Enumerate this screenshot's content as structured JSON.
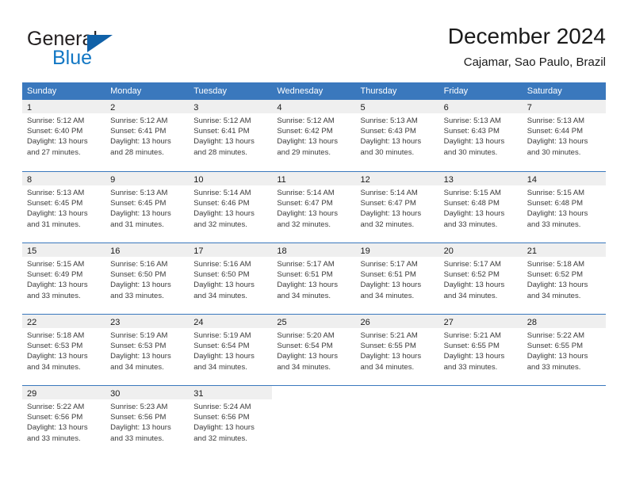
{
  "logo": {
    "word_one": "General",
    "word_two": "Blue",
    "triangle_color": "#1061a8",
    "blue_text_color": "#1277c4"
  },
  "header": {
    "title": "December 2024",
    "location": "Cajamar, Sao Paulo, Brazil"
  },
  "theme": {
    "header_blue": "#3a78bd",
    "day_band_gray": "#efefef",
    "text_color": "#3a3a3a"
  },
  "weekdays": [
    "Sunday",
    "Monday",
    "Tuesday",
    "Wednesday",
    "Thursday",
    "Friday",
    "Saturday"
  ],
  "weeks": [
    [
      {
        "day": "1",
        "sunrise": "Sunrise: 5:12 AM",
        "sunset": "Sunset: 6:40 PM",
        "daylight_1": "Daylight: 13 hours",
        "daylight_2": "and 27 minutes."
      },
      {
        "day": "2",
        "sunrise": "Sunrise: 5:12 AM",
        "sunset": "Sunset: 6:41 PM",
        "daylight_1": "Daylight: 13 hours",
        "daylight_2": "and 28 minutes."
      },
      {
        "day": "3",
        "sunrise": "Sunrise: 5:12 AM",
        "sunset": "Sunset: 6:41 PM",
        "daylight_1": "Daylight: 13 hours",
        "daylight_2": "and 28 minutes."
      },
      {
        "day": "4",
        "sunrise": "Sunrise: 5:12 AM",
        "sunset": "Sunset: 6:42 PM",
        "daylight_1": "Daylight: 13 hours",
        "daylight_2": "and 29 minutes."
      },
      {
        "day": "5",
        "sunrise": "Sunrise: 5:13 AM",
        "sunset": "Sunset: 6:43 PM",
        "daylight_1": "Daylight: 13 hours",
        "daylight_2": "and 30 minutes."
      },
      {
        "day": "6",
        "sunrise": "Sunrise: 5:13 AM",
        "sunset": "Sunset: 6:43 PM",
        "daylight_1": "Daylight: 13 hours",
        "daylight_2": "and 30 minutes."
      },
      {
        "day": "7",
        "sunrise": "Sunrise: 5:13 AM",
        "sunset": "Sunset: 6:44 PM",
        "daylight_1": "Daylight: 13 hours",
        "daylight_2": "and 30 minutes."
      }
    ],
    [
      {
        "day": "8",
        "sunrise": "Sunrise: 5:13 AM",
        "sunset": "Sunset: 6:45 PM",
        "daylight_1": "Daylight: 13 hours",
        "daylight_2": "and 31 minutes."
      },
      {
        "day": "9",
        "sunrise": "Sunrise: 5:13 AM",
        "sunset": "Sunset: 6:45 PM",
        "daylight_1": "Daylight: 13 hours",
        "daylight_2": "and 31 minutes."
      },
      {
        "day": "10",
        "sunrise": "Sunrise: 5:14 AM",
        "sunset": "Sunset: 6:46 PM",
        "daylight_1": "Daylight: 13 hours",
        "daylight_2": "and 32 minutes."
      },
      {
        "day": "11",
        "sunrise": "Sunrise: 5:14 AM",
        "sunset": "Sunset: 6:47 PM",
        "daylight_1": "Daylight: 13 hours",
        "daylight_2": "and 32 minutes."
      },
      {
        "day": "12",
        "sunrise": "Sunrise: 5:14 AM",
        "sunset": "Sunset: 6:47 PM",
        "daylight_1": "Daylight: 13 hours",
        "daylight_2": "and 32 minutes."
      },
      {
        "day": "13",
        "sunrise": "Sunrise: 5:15 AM",
        "sunset": "Sunset: 6:48 PM",
        "daylight_1": "Daylight: 13 hours",
        "daylight_2": "and 33 minutes."
      },
      {
        "day": "14",
        "sunrise": "Sunrise: 5:15 AM",
        "sunset": "Sunset: 6:48 PM",
        "daylight_1": "Daylight: 13 hours",
        "daylight_2": "and 33 minutes."
      }
    ],
    [
      {
        "day": "15",
        "sunrise": "Sunrise: 5:15 AM",
        "sunset": "Sunset: 6:49 PM",
        "daylight_1": "Daylight: 13 hours",
        "daylight_2": "and 33 minutes."
      },
      {
        "day": "16",
        "sunrise": "Sunrise: 5:16 AM",
        "sunset": "Sunset: 6:50 PM",
        "daylight_1": "Daylight: 13 hours",
        "daylight_2": "and 33 minutes."
      },
      {
        "day": "17",
        "sunrise": "Sunrise: 5:16 AM",
        "sunset": "Sunset: 6:50 PM",
        "daylight_1": "Daylight: 13 hours",
        "daylight_2": "and 34 minutes."
      },
      {
        "day": "18",
        "sunrise": "Sunrise: 5:17 AM",
        "sunset": "Sunset: 6:51 PM",
        "daylight_1": "Daylight: 13 hours",
        "daylight_2": "and 34 minutes."
      },
      {
        "day": "19",
        "sunrise": "Sunrise: 5:17 AM",
        "sunset": "Sunset: 6:51 PM",
        "daylight_1": "Daylight: 13 hours",
        "daylight_2": "and 34 minutes."
      },
      {
        "day": "20",
        "sunrise": "Sunrise: 5:17 AM",
        "sunset": "Sunset: 6:52 PM",
        "daylight_1": "Daylight: 13 hours",
        "daylight_2": "and 34 minutes."
      },
      {
        "day": "21",
        "sunrise": "Sunrise: 5:18 AM",
        "sunset": "Sunset: 6:52 PM",
        "daylight_1": "Daylight: 13 hours",
        "daylight_2": "and 34 minutes."
      }
    ],
    [
      {
        "day": "22",
        "sunrise": "Sunrise: 5:18 AM",
        "sunset": "Sunset: 6:53 PM",
        "daylight_1": "Daylight: 13 hours",
        "daylight_2": "and 34 minutes."
      },
      {
        "day": "23",
        "sunrise": "Sunrise: 5:19 AM",
        "sunset": "Sunset: 6:53 PM",
        "daylight_1": "Daylight: 13 hours",
        "daylight_2": "and 34 minutes."
      },
      {
        "day": "24",
        "sunrise": "Sunrise: 5:19 AM",
        "sunset": "Sunset: 6:54 PM",
        "daylight_1": "Daylight: 13 hours",
        "daylight_2": "and 34 minutes."
      },
      {
        "day": "25",
        "sunrise": "Sunrise: 5:20 AM",
        "sunset": "Sunset: 6:54 PM",
        "daylight_1": "Daylight: 13 hours",
        "daylight_2": "and 34 minutes."
      },
      {
        "day": "26",
        "sunrise": "Sunrise: 5:21 AM",
        "sunset": "Sunset: 6:55 PM",
        "daylight_1": "Daylight: 13 hours",
        "daylight_2": "and 34 minutes."
      },
      {
        "day": "27",
        "sunrise": "Sunrise: 5:21 AM",
        "sunset": "Sunset: 6:55 PM",
        "daylight_1": "Daylight: 13 hours",
        "daylight_2": "and 33 minutes."
      },
      {
        "day": "28",
        "sunrise": "Sunrise: 5:22 AM",
        "sunset": "Sunset: 6:55 PM",
        "daylight_1": "Daylight: 13 hours",
        "daylight_2": "and 33 minutes."
      }
    ],
    [
      {
        "day": "29",
        "sunrise": "Sunrise: 5:22 AM",
        "sunset": "Sunset: 6:56 PM",
        "daylight_1": "Daylight: 13 hours",
        "daylight_2": "and 33 minutes."
      },
      {
        "day": "30",
        "sunrise": "Sunrise: 5:23 AM",
        "sunset": "Sunset: 6:56 PM",
        "daylight_1": "Daylight: 13 hours",
        "daylight_2": "and 33 minutes."
      },
      {
        "day": "31",
        "sunrise": "Sunrise: 5:24 AM",
        "sunset": "Sunset: 6:56 PM",
        "daylight_1": "Daylight: 13 hours",
        "daylight_2": "and 32 minutes."
      },
      {
        "day": "",
        "sunrise": "",
        "sunset": "",
        "daylight_1": "",
        "daylight_2": ""
      },
      {
        "day": "",
        "sunrise": "",
        "sunset": "",
        "daylight_1": "",
        "daylight_2": ""
      },
      {
        "day": "",
        "sunrise": "",
        "sunset": "",
        "daylight_1": "",
        "daylight_2": ""
      },
      {
        "day": "",
        "sunrise": "",
        "sunset": "",
        "daylight_1": "",
        "daylight_2": ""
      }
    ]
  ]
}
